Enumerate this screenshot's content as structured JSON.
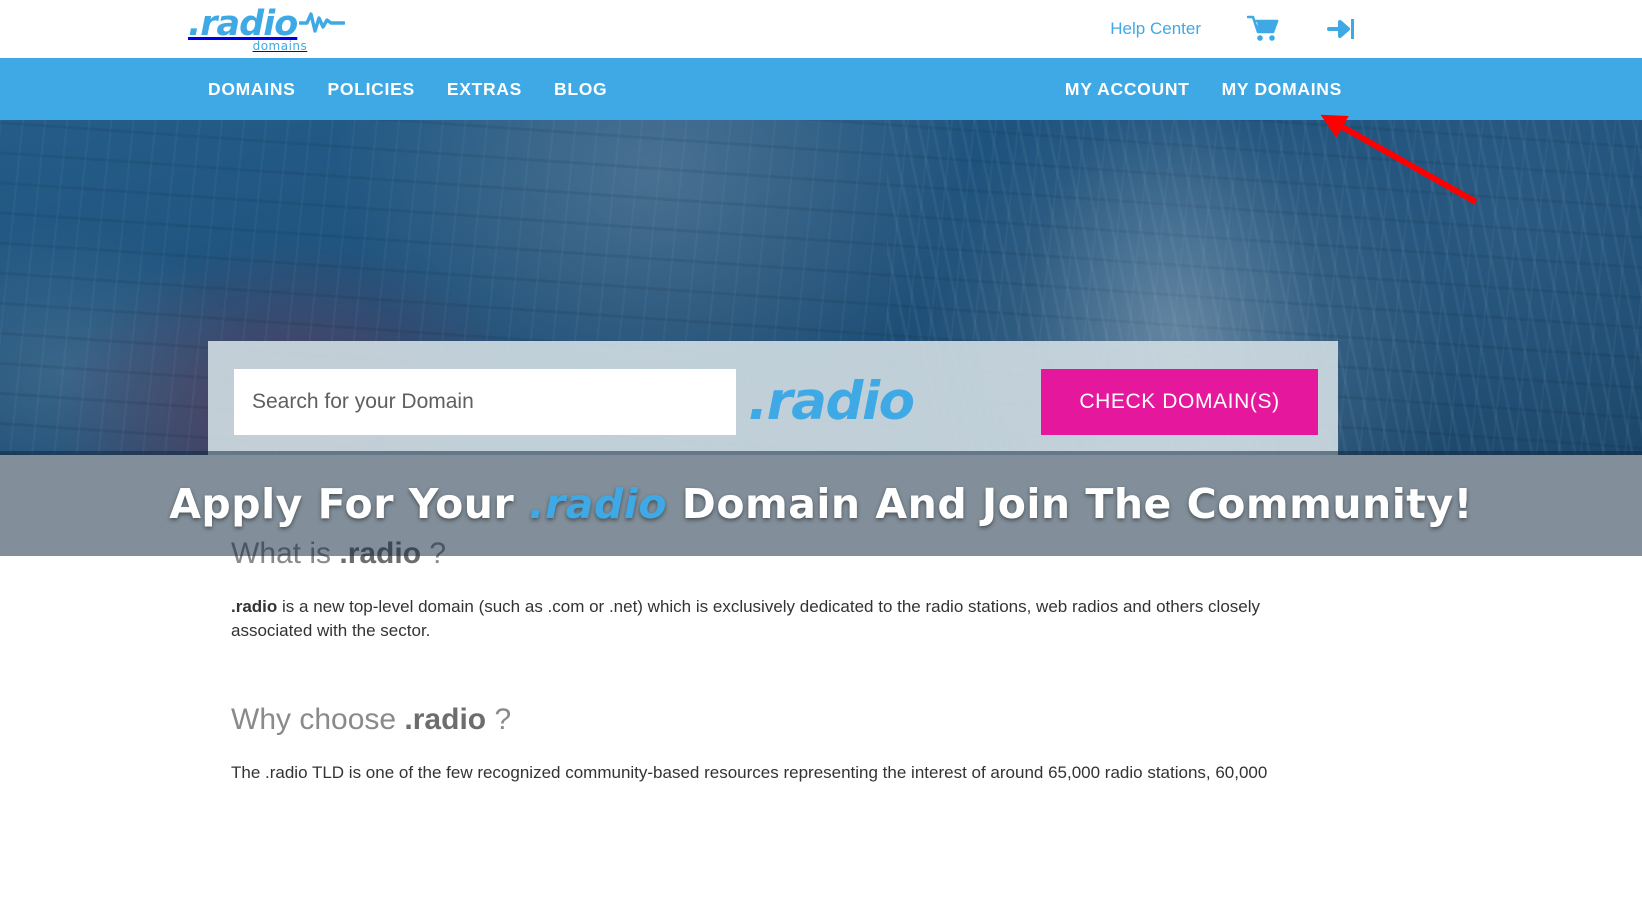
{
  "header": {
    "logo": {
      "main": ".radio",
      "sub": "domains",
      "wave_icon": "audio-waveform-icon"
    },
    "help_center": "Help Center",
    "cart_icon": "shopping-cart-icon",
    "login_icon": "sign-in-arrow-icon"
  },
  "nav": {
    "left": [
      {
        "label": "DOMAINS"
      },
      {
        "label": "POLICIES"
      },
      {
        "label": "EXTRAS"
      },
      {
        "label": "BLOG"
      }
    ],
    "right": [
      {
        "label": "MY ACCOUNT"
      },
      {
        "label": "MY DOMAINS"
      }
    ]
  },
  "hero": {
    "search": {
      "placeholder": "Search for your Domain",
      "value": ""
    },
    "tld_label": ".radio",
    "check_button": "CHECK DOMAIN(S)",
    "tagline_before": "Apply For Your ",
    "tagline_tld": ".radio",
    "tagline_after": " Domain And Join The Community!"
  },
  "content": {
    "section1": {
      "heading_plain": "What is ",
      "heading_strong": ".radio",
      "heading_suffix": " ?",
      "body_bold": ".radio",
      "body_rest": " is a new top-level domain (such as .com or .net) which is exclusively dedicated to the radio stations, web radios and others closely associated with the sector."
    },
    "section2": {
      "heading_plain": "Why choose ",
      "heading_strong": ".radio",
      "heading_suffix": " ?",
      "body": "The .radio TLD is one of the few recognized community-based resources representing the interest of around 65,000 radio stations, 60,000"
    }
  },
  "annotation": {
    "arrow_icon": "red-pointer-arrow",
    "color": "#FF0000",
    "points_to": "MY DOMAINS"
  },
  "colors": {
    "brand_blue": "#3FA9E5",
    "accent_pink": "#E5179C",
    "panel_grey": "#CCD9E0",
    "text_dark": "#333333",
    "heading_grey": "#8A8A8A"
  }
}
